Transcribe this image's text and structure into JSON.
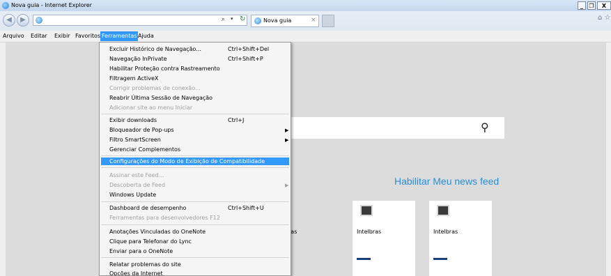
{
  "window": {
    "title": "Nova guia - Internet Explorer",
    "controls": [
      "_",
      "❐",
      "X"
    ]
  },
  "navbar": {
    "back_icon": "back-arrow-icon",
    "forward_icon": "forward-arrow-icon",
    "address_value": "",
    "search_glyph": "⌕",
    "dropdown_glyph": "▾",
    "refresh_glyph": "↻",
    "tab_label": "Nova guia",
    "tab_close": "×",
    "right_icons": "⌂ ☆ ⚙"
  },
  "menubar": {
    "items": [
      "Arquivo",
      "Editar",
      "Exibir",
      "Favoritos",
      "Ferramentas",
      "Ajuda"
    ],
    "active": "Ferramentas"
  },
  "tools_menu": {
    "groups": [
      [
        {
          "label": "Excluir Histórico de Navegação...",
          "shortcut": "Ctrl+Shift+Del",
          "disabled": false
        },
        {
          "label": "Navegação InPrivate",
          "shortcut": "Ctrl+Shift+P",
          "disabled": false
        },
        {
          "label": "Habilitar Proteção contra Rastreamento",
          "shortcut": "",
          "disabled": false
        },
        {
          "label": "Filtragem ActiveX",
          "shortcut": "",
          "disabled": false
        },
        {
          "label": "Corrigir problemas de conexão...",
          "shortcut": "",
          "disabled": true
        },
        {
          "label": "Reabrir Última Sessão de Navegação",
          "shortcut": "",
          "disabled": false
        },
        {
          "label": "Adicionar site ao menu Iniciar",
          "shortcut": "",
          "disabled": true
        }
      ],
      [
        {
          "label": "Exibir downloads",
          "shortcut": "Ctrl+J",
          "disabled": false
        },
        {
          "label": "Bloqueador de Pop-ups",
          "shortcut": "",
          "submenu": true,
          "disabled": false
        },
        {
          "label": "Filtro SmartScreen",
          "shortcut": "",
          "submenu": true,
          "disabled": false
        },
        {
          "label": "Gerenciar Complementos",
          "shortcut": "",
          "disabled": false
        }
      ],
      [
        {
          "label": "Configurações do Modo de Exibição de Compatibilidade",
          "shortcut": "",
          "disabled": false,
          "highlighted": true
        }
      ],
      [
        {
          "label": "Assinar este Feed...",
          "shortcut": "",
          "disabled": true
        },
        {
          "label": "Descoberta de Feed",
          "shortcut": "",
          "submenu": true,
          "disabled": true
        },
        {
          "label": "Windows Update",
          "shortcut": "",
          "disabled": false
        }
      ],
      [
        {
          "label": "Dashboard de desempenho",
          "shortcut": "Ctrl+Shift+U",
          "disabled": false
        },
        {
          "label": "Ferramentas para desenvolvedores F12",
          "shortcut": "",
          "disabled": true
        }
      ],
      [
        {
          "label": "Anotações Vinculadas do OneNote",
          "shortcut": "",
          "disabled": false
        },
        {
          "label": "Clique para Telefonar do Lync",
          "shortcut": "",
          "disabled": false
        },
        {
          "label": "Enviar para o OneNote",
          "shortcut": "",
          "disabled": false
        }
      ],
      [
        {
          "label": "Relatar problemas do site",
          "shortcut": "",
          "disabled": false
        },
        {
          "label": "Opções da Internet",
          "shortcut": "",
          "disabled": false
        }
      ]
    ]
  },
  "newtab_page": {
    "search_placeholder": "",
    "search_icon": "⚲",
    "newsfeed_link": "Habilitar Meu news feed",
    "partial_tile_label": "ras",
    "tiles": [
      {
        "name": "Intelbras"
      },
      {
        "name": "Intelbras"
      }
    ]
  }
}
